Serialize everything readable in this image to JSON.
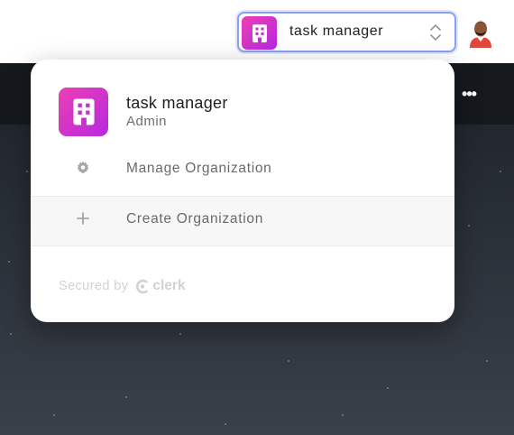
{
  "header": {
    "org_switcher": {
      "name": "task manager",
      "logo_icon": "building-icon",
      "chevron_icon": "chevrons-up-down-icon"
    },
    "avatar_icon": "user-avatar"
  },
  "background": {
    "more_icon": "ellipsis-icon",
    "more_text": "•••"
  },
  "popover": {
    "org": {
      "name": "task manager",
      "role": "Admin",
      "logo_icon": "building-icon"
    },
    "menu": [
      {
        "label": "Manage Organization",
        "icon": "gear-icon"
      },
      {
        "label": "Create Organization",
        "icon": "plus-icon"
      }
    ],
    "footer": {
      "secured_text": "Secured by",
      "brand": "clerk",
      "brand_icon": "clerk-logo-icon"
    }
  },
  "colors": {
    "brand_gradient_start": "#ec3fb3",
    "brand_gradient_end": "#b629e0",
    "switcher_border": "#8aa0f0"
  }
}
